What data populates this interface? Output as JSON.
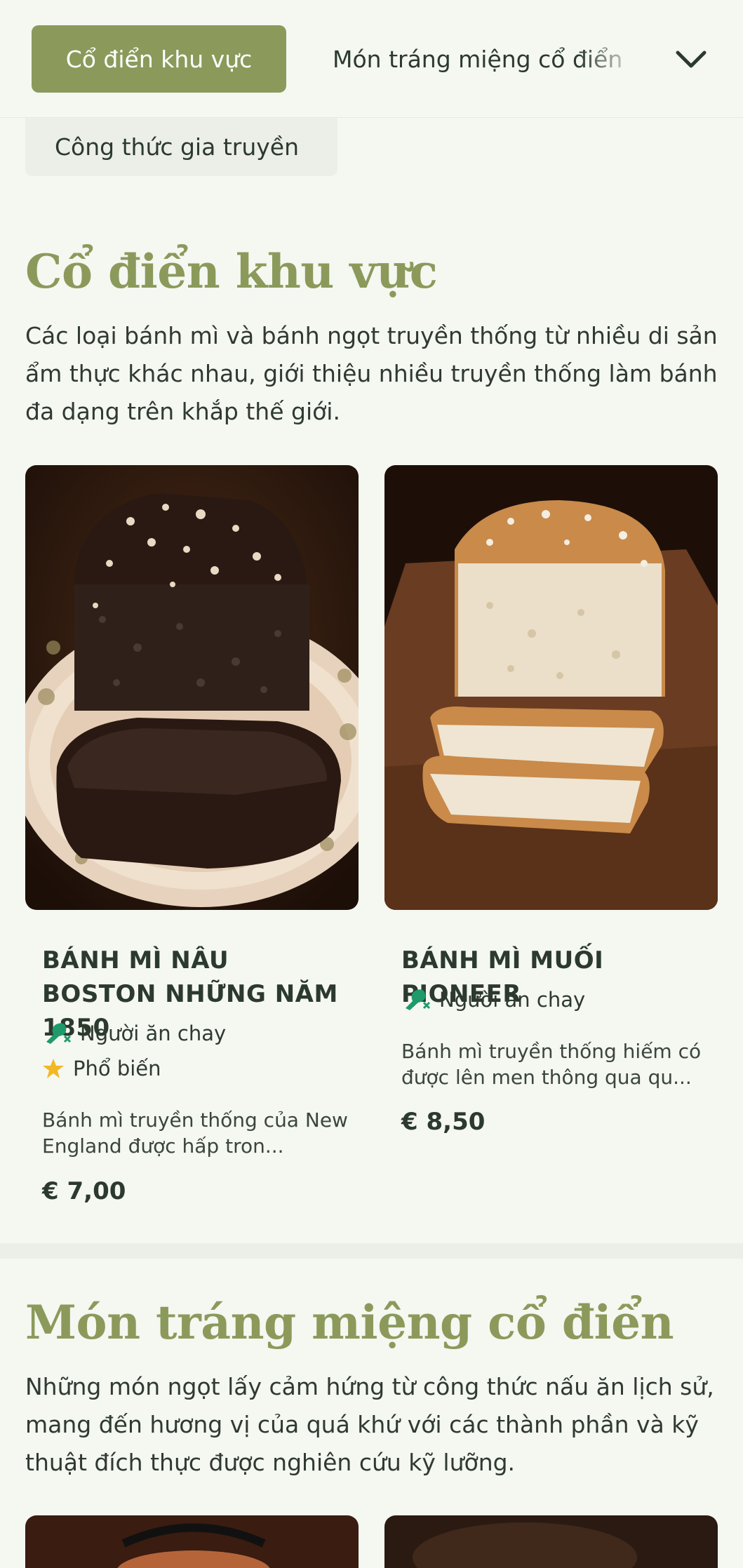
{
  "nav": {
    "active_tab": "Cổ điển khu vực",
    "next_tab": "Món tráng miệng cổ điển",
    "below_tab": "Công thức gia truyền",
    "chevron_icon": "chevron-down-icon"
  },
  "sections": [
    {
      "title": "Cổ điển khu vực",
      "description": "Các loại bánh mì và bánh ngọt truyền thống từ nhiều di sản ẩm thực khác nhau, giới thiệu nhiều truyền thống làm bánh đa dạng trên khắp thế giới.",
      "items": [
        {
          "name": "BÁNH MÌ NÂU BOSTON NHỮNG NĂM 1850",
          "tags": [
            {
              "label": "Người ăn chay",
              "icon": "vegetarian-leg-icon"
            },
            {
              "label": "Phổ biến",
              "icon": "star-icon"
            }
          ],
          "description": "Bánh mì truyền thống của New England được hấp tron...",
          "price": "€ 7,00"
        },
        {
          "name": "BÁNH MÌ MUỐI PIONEER",
          "tags": [
            {
              "label": "Người ăn chay",
              "icon": "vegetarian-leg-icon"
            }
          ],
          "description": "Bánh mì truyền thống hiếm có được lên men thông qua qu...",
          "price": "€ 8,50"
        }
      ]
    },
    {
      "title": "Món tráng miệng cổ điển",
      "description": "Những món ngọt lấy cảm hứng từ công thức nấu ăn lịch sử, mang đến hương vị của quá khứ với các thành phần và kỹ thuật đích thực được nghiên cứu kỹ lưỡng."
    }
  ],
  "colors": {
    "accent": "#8b9a5b",
    "background": "#f5f7f1",
    "text": "#2c3a2e",
    "veg_icon": "#1f9a6b",
    "star": "#f2b824"
  }
}
